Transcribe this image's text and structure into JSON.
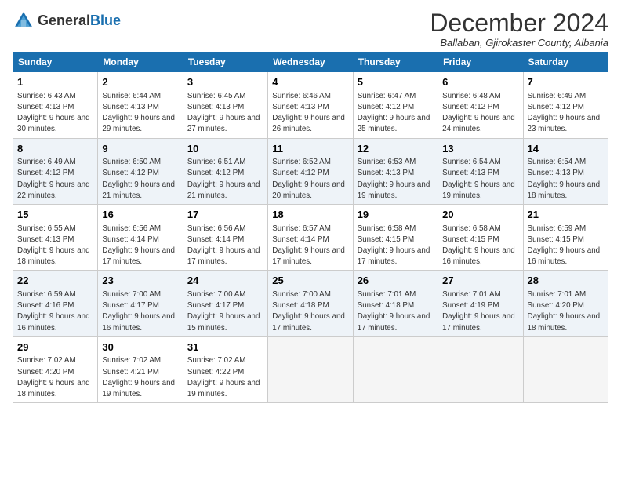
{
  "logo": {
    "general": "General",
    "blue": "Blue"
  },
  "title": "December 2024",
  "location": "Ballaban, Gjirokaster County, Albania",
  "days_header": [
    "Sunday",
    "Monday",
    "Tuesday",
    "Wednesday",
    "Thursday",
    "Friday",
    "Saturday"
  ],
  "weeks": [
    [
      {
        "day": "1",
        "sunrise": "6:43 AM",
        "sunset": "4:13 PM",
        "daylight": "9 hours and 30 minutes."
      },
      {
        "day": "2",
        "sunrise": "6:44 AM",
        "sunset": "4:13 PM",
        "daylight": "9 hours and 29 minutes."
      },
      {
        "day": "3",
        "sunrise": "6:45 AM",
        "sunset": "4:13 PM",
        "daylight": "9 hours and 27 minutes."
      },
      {
        "day": "4",
        "sunrise": "6:46 AM",
        "sunset": "4:13 PM",
        "daylight": "9 hours and 26 minutes."
      },
      {
        "day": "5",
        "sunrise": "6:47 AM",
        "sunset": "4:12 PM",
        "daylight": "9 hours and 25 minutes."
      },
      {
        "day": "6",
        "sunrise": "6:48 AM",
        "sunset": "4:12 PM",
        "daylight": "9 hours and 24 minutes."
      },
      {
        "day": "7",
        "sunrise": "6:49 AM",
        "sunset": "4:12 PM",
        "daylight": "9 hours and 23 minutes."
      }
    ],
    [
      {
        "day": "8",
        "sunrise": "6:49 AM",
        "sunset": "4:12 PM",
        "daylight": "9 hours and 22 minutes."
      },
      {
        "day": "9",
        "sunrise": "6:50 AM",
        "sunset": "4:12 PM",
        "daylight": "9 hours and 21 minutes."
      },
      {
        "day": "10",
        "sunrise": "6:51 AM",
        "sunset": "4:12 PM",
        "daylight": "9 hours and 21 minutes."
      },
      {
        "day": "11",
        "sunrise": "6:52 AM",
        "sunset": "4:12 PM",
        "daylight": "9 hours and 20 minutes."
      },
      {
        "day": "12",
        "sunrise": "6:53 AM",
        "sunset": "4:13 PM",
        "daylight": "9 hours and 19 minutes."
      },
      {
        "day": "13",
        "sunrise": "6:54 AM",
        "sunset": "4:13 PM",
        "daylight": "9 hours and 19 minutes."
      },
      {
        "day": "14",
        "sunrise": "6:54 AM",
        "sunset": "4:13 PM",
        "daylight": "9 hours and 18 minutes."
      }
    ],
    [
      {
        "day": "15",
        "sunrise": "6:55 AM",
        "sunset": "4:13 PM",
        "daylight": "9 hours and 18 minutes."
      },
      {
        "day": "16",
        "sunrise": "6:56 AM",
        "sunset": "4:14 PM",
        "daylight": "9 hours and 17 minutes."
      },
      {
        "day": "17",
        "sunrise": "6:56 AM",
        "sunset": "4:14 PM",
        "daylight": "9 hours and 17 minutes."
      },
      {
        "day": "18",
        "sunrise": "6:57 AM",
        "sunset": "4:14 PM",
        "daylight": "9 hours and 17 minutes."
      },
      {
        "day": "19",
        "sunrise": "6:58 AM",
        "sunset": "4:15 PM",
        "daylight": "9 hours and 17 minutes."
      },
      {
        "day": "20",
        "sunrise": "6:58 AM",
        "sunset": "4:15 PM",
        "daylight": "9 hours and 16 minutes."
      },
      {
        "day": "21",
        "sunrise": "6:59 AM",
        "sunset": "4:15 PM",
        "daylight": "9 hours and 16 minutes."
      }
    ],
    [
      {
        "day": "22",
        "sunrise": "6:59 AM",
        "sunset": "4:16 PM",
        "daylight": "9 hours and 16 minutes."
      },
      {
        "day": "23",
        "sunrise": "7:00 AM",
        "sunset": "4:17 PM",
        "daylight": "9 hours and 16 minutes."
      },
      {
        "day": "24",
        "sunrise": "7:00 AM",
        "sunset": "4:17 PM",
        "daylight": "9 hours and 15 minutes."
      },
      {
        "day": "25",
        "sunrise": "7:00 AM",
        "sunset": "4:18 PM",
        "daylight": "9 hours and 17 minutes."
      },
      {
        "day": "26",
        "sunrise": "7:01 AM",
        "sunset": "4:18 PM",
        "daylight": "9 hours and 17 minutes."
      },
      {
        "day": "27",
        "sunrise": "7:01 AM",
        "sunset": "4:19 PM",
        "daylight": "9 hours and 17 minutes."
      },
      {
        "day": "28",
        "sunrise": "7:01 AM",
        "sunset": "4:20 PM",
        "daylight": "9 hours and 18 minutes."
      }
    ],
    [
      {
        "day": "29",
        "sunrise": "7:02 AM",
        "sunset": "4:20 PM",
        "daylight": "9 hours and 18 minutes."
      },
      {
        "day": "30",
        "sunrise": "7:02 AM",
        "sunset": "4:21 PM",
        "daylight": "9 hours and 19 minutes."
      },
      {
        "day": "31",
        "sunrise": "7:02 AM",
        "sunset": "4:22 PM",
        "daylight": "9 hours and 19 minutes."
      },
      null,
      null,
      null,
      null
    ]
  ]
}
